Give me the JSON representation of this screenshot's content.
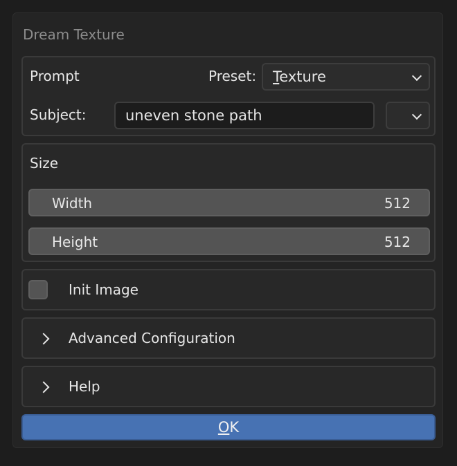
{
  "dialog": {
    "title": "Dream Texture"
  },
  "prompt_panel": {
    "heading": "Prompt",
    "preset_label": "Preset:",
    "preset_value_accel": "T",
    "preset_value_rest": "exture",
    "subject_label": "Subject:",
    "subject_value": "uneven stone path"
  },
  "size_panel": {
    "heading": "Size",
    "width_label": "Width",
    "width_value": "512",
    "height_label": "Height",
    "height_value": "512"
  },
  "init_image": {
    "label": "Init Image",
    "checked": false
  },
  "advanced": {
    "label": "Advanced Configuration"
  },
  "help": {
    "label": "Help"
  },
  "ok_button": {
    "accel": "O",
    "rest": "K"
  },
  "colors": {
    "accent": "#4772b3",
    "background": "#1d1d1d",
    "panel": "#282828",
    "slider": "#545454"
  }
}
